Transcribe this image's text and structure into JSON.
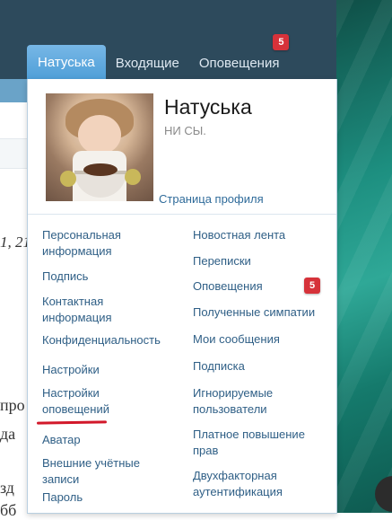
{
  "tabs": {
    "profile": "Натуська",
    "inbox": "Входящие",
    "alerts": "Оповещения",
    "alerts_badge": "5"
  },
  "profile": {
    "name": "Натуська",
    "status": "НИ СЫ.",
    "profile_link": "Страница профиля"
  },
  "menu_left": [
    "Персональная\nинформация",
    "Подпись",
    "Контактная\nинформация",
    "Конфиденциальность",
    "Настройки",
    "Настройки\nоповещений",
    "Аватар",
    "Внешние учётные\nзаписи",
    "Пароль"
  ],
  "menu_right": [
    "Новостная лента",
    "Переписки",
    "Оповещения",
    "Полученные симпатии",
    "Мои сообщения",
    "Подписка",
    "Игнорируемые\nпользователи",
    "Платное повышение\nправ",
    "Двухфакторная\nаутентификация"
  ],
  "menu_right_alerts_badge": "5",
  "background_fragments": {
    "date": "1, 21",
    "line1": "про",
    "line2": "да",
    "line3": "зд",
    "line4": "бб"
  },
  "colors": {
    "header": "#2d4a5c",
    "tab_active": "#4f9fd8",
    "link": "#2f5f86",
    "badge": "#d6323a",
    "underline": "#d2182a",
    "teal_bg": "#1d8f80"
  }
}
